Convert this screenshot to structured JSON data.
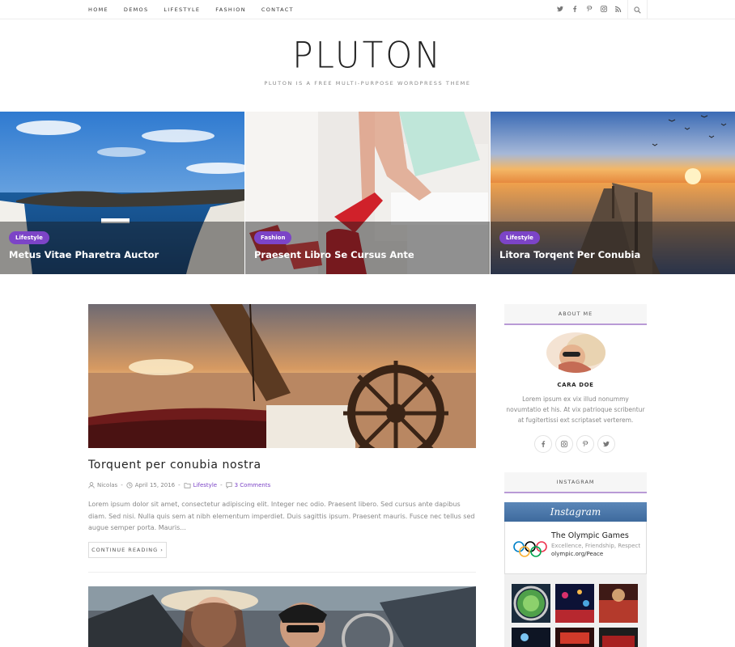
{
  "nav": {
    "items": [
      "HOME",
      "DEMOS",
      "LIFESTYLE",
      "FASHION",
      "CONTACT"
    ]
  },
  "header": {
    "logo": "PLUTON",
    "tagline": "PLUTON IS A FREE MULTI-PURPOSE WORDPRESS THEME"
  },
  "slider": {
    "slides": [
      {
        "category": "Lifestyle",
        "title": "Metus Vitae Pharetra Auctor"
      },
      {
        "category": "Fashion",
        "title": "Praesent Libro Se Cursus Ante"
      },
      {
        "category": "Lifestyle",
        "title": "Litora Torqent Per Conubia"
      }
    ]
  },
  "post": {
    "title": "Torquent per conubia nostra",
    "author": "Nicolas",
    "date": "April 15, 2016",
    "category": "Lifestyle",
    "comments": "3 Comments",
    "excerpt": "Lorem ipsum dolor sit amet, consectetur adipiscing elit. Integer nec odio. Praesent libero. Sed cursus ante dapibus diam. Sed nisi. Nulla quis sem at nibh elementum imperdiet. Duis sagittis ipsum. Praesent mauris. Fusce nec tellus sed augue semper porta. Mauris...",
    "button": "CONTINUE READING ›"
  },
  "sidebar": {
    "about_heading": "ABOUT ME",
    "about_name": "CARA DOE",
    "about_text": "Lorem ipsum ex vix illud nonummy novumtatio et his. At vix patrioque scribentur at fugitertissi ext scriptaset verterem.",
    "instagram_heading": "INSTAGRAM",
    "instagram_bar": "Instagram",
    "ig_name": "The Olympic Games",
    "ig_desc": "Excellence, Friendship, Respect",
    "ig_link": "olympic.org/Peace"
  },
  "colors": {
    "accent": "#7c44c7",
    "widget_underline": "#b99ad6"
  }
}
